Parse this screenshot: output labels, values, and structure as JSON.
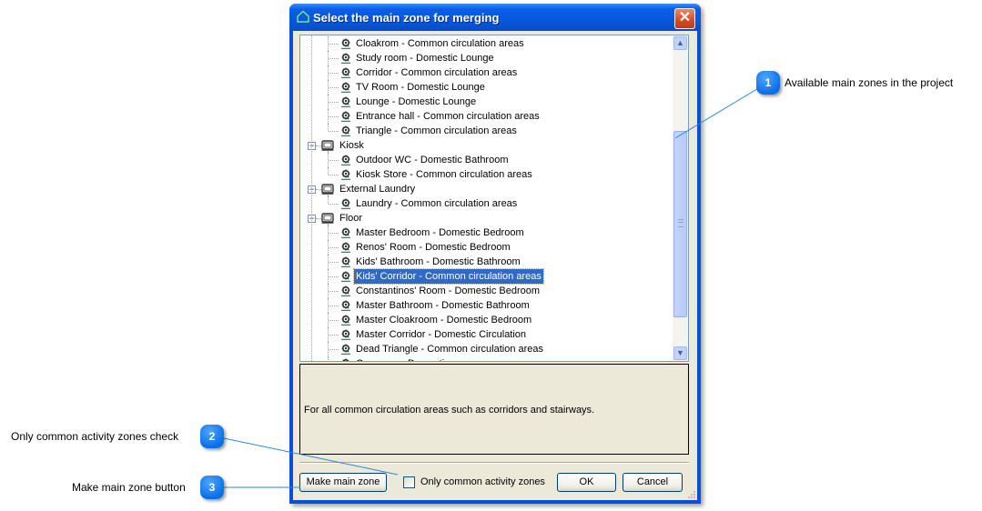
{
  "dialog": {
    "title": "Select the main zone for merging",
    "close_label": "✕",
    "tree": {
      "rows": [
        {
          "type": "zone",
          "label": "Cloakrom - Common circulation areas"
        },
        {
          "type": "zone",
          "label": "Study room - Domestic Lounge"
        },
        {
          "type": "zone",
          "label": "Corridor - Common circulation areas"
        },
        {
          "type": "zone",
          "label": "TV Room - Domestic Lounge"
        },
        {
          "type": "zone",
          "label": "Lounge - Domestic Lounge"
        },
        {
          "type": "zone",
          "label": "Entrance hall - Common circulation areas"
        },
        {
          "type": "zone",
          "label": "Triangle - Common circulation areas"
        },
        {
          "type": "group",
          "label": "Kiosk",
          "expanded": true
        },
        {
          "type": "zone",
          "label": "Outdoor  WC - Domestic Bathroom"
        },
        {
          "type": "zone",
          "label": "Kiosk Store - Common circulation areas"
        },
        {
          "type": "group",
          "label": "External Laundry",
          "expanded": true
        },
        {
          "type": "zone",
          "label": "Laundry - Common circulation areas"
        },
        {
          "type": "group",
          "label": "Floor",
          "expanded": true
        },
        {
          "type": "zone",
          "label": "Master Bedroom - Domestic Bedroom"
        },
        {
          "type": "zone",
          "label": "Renos' Room - Domestic Bedroom"
        },
        {
          "type": "zone",
          "label": "Kids' Bathroom - Domestic Bathroom"
        },
        {
          "type": "zone",
          "label": "Kids' Corridor - Common circulation areas",
          "selected": true
        },
        {
          "type": "zone",
          "label": "Constantinos' Room - Domestic Bedroom"
        },
        {
          "type": "zone",
          "label": "Master Bathroom - Domestic Bathroom"
        },
        {
          "type": "zone",
          "label": "Master Cloakroom - Domestic Bedroom"
        },
        {
          "type": "zone",
          "label": "Master Corridor - Domestic Circulation"
        },
        {
          "type": "zone",
          "label": "Dead Triangle - Common circulation areas"
        },
        {
          "type": "zone",
          "label": "Gxxxxxxx - Domestic ..."
        }
      ]
    },
    "description": "For all common circulation areas such as corridors and stairways.",
    "buttons": {
      "make_main_zone": "Make main zone",
      "ok": "OK",
      "cancel": "Cancel"
    },
    "checkbox": {
      "label": "Only common activity zones",
      "checked": false
    }
  },
  "callouts": [
    {
      "number": "1",
      "text": "Available main zones in the project"
    },
    {
      "number": "2",
      "text": "Only common activity zones check"
    },
    {
      "number": "3",
      "text": "Make main zone button"
    }
  ],
  "colors": {
    "titlebar": "#0756d8",
    "selection": "#316ac5",
    "callout": "#0d6fe8",
    "dialog_face": "#ece9d8"
  }
}
